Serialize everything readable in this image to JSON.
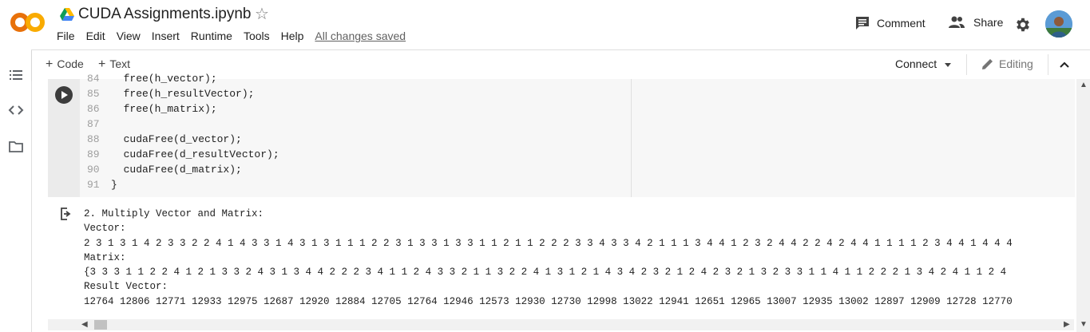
{
  "app": {
    "logo_text": "CO",
    "doc_title": "CUDA Assignments.ipynb",
    "menu": [
      "File",
      "Edit",
      "View",
      "Insert",
      "Runtime",
      "Tools",
      "Help"
    ],
    "save_status": "All changes saved",
    "comment_label": "Comment",
    "share_label": "Share",
    "colors": {
      "logo_orange": "#f9ab00",
      "logo_dark": "#e8710a"
    }
  },
  "toolbar": {
    "add_code_label": "Code",
    "add_text_label": "Text",
    "connect_label": "Connect",
    "editing_label": "Editing"
  },
  "left_rail": {
    "icons": [
      "toc-icon",
      "code-snippets-icon",
      "folder-icon"
    ]
  },
  "cell": {
    "lines": [
      {
        "n": "84",
        "code": "  free(h_vector);"
      },
      {
        "n": "85",
        "code": "  free(h_resultVector);"
      },
      {
        "n": "86",
        "code": "  free(h_matrix);"
      },
      {
        "n": "87",
        "code": ""
      },
      {
        "n": "88",
        "code": "  cudaFree(d_vector);"
      },
      {
        "n": "89",
        "code": "  cudaFree(d_resultVector);"
      },
      {
        "n": "90",
        "code": "  cudaFree(d_matrix);"
      },
      {
        "n": "91",
        "code": "}"
      }
    ]
  },
  "output": {
    "lines": [
      "2. Multiply Vector and Matrix:",
      "Vector:",
      "2 3 1 3 1 4 2 3 3 2 2 4 1 4 3 3 1 4 3 1 3 1 1 1 2 2 3 1 3 3 1 3 3 1 1 2 1 1 2 2 2 3 3 4 3 3 4 2 1 1 1 3 4 4 1 2 3 2 4 4 2 2 4 2 4 4 1 1 1 1 2 3 4 4 1 4 4 4",
      "Matrix:",
      "{3 3 3 1 1 2 2 4 1 2 1 3 3 2 4 3 1 3 4 4 2 2 2 3 4 1 1 2 4 3 3 2 1 1 3 2 2 4 1 3 1 2 1 4 3 4 2 3 2 1 2 4 2 3 2 1 3 2 3 3 1 1 4 1 1 2 2 2 1 3 4 2 4 1 1 2 4",
      "Result Vector:",
      "12764 12806 12771 12933 12975 12687 12920 12884 12705 12764 12946 12573 12930 12730 12998 13022 12941 12651 12965 13007 12935 13002 12897 12909 12728 12770"
    ]
  }
}
